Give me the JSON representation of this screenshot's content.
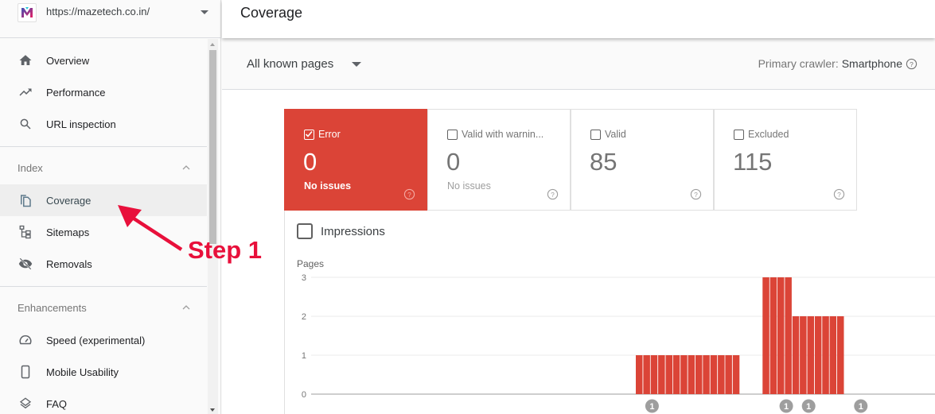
{
  "property": {
    "url": "https://mazetech.co.in/",
    "logo_icon": "mazetech-logo",
    "dropdown_icon": "caret-down-icon"
  },
  "sidebar": {
    "top_items": [
      {
        "label": "Overview",
        "icon": "home-icon"
      },
      {
        "label": "Performance",
        "icon": "trending-up-icon"
      },
      {
        "label": "URL inspection",
        "icon": "search-icon"
      }
    ],
    "sections": [
      {
        "title": "Index",
        "expanded": true,
        "items": [
          {
            "label": "Coverage",
            "icon": "coverage-copy-icon",
            "active": true
          },
          {
            "label": "Sitemaps",
            "icon": "sitemap-icon"
          },
          {
            "label": "Removals",
            "icon": "eye-off-icon"
          }
        ]
      },
      {
        "title": "Enhancements",
        "expanded": true,
        "items": [
          {
            "label": "Speed (experimental)",
            "icon": "speedometer-icon"
          },
          {
            "label": "Mobile Usability",
            "icon": "smartphone-icon"
          },
          {
            "label": "FAQ",
            "icon": "layers-icon"
          }
        ]
      }
    ]
  },
  "header": {
    "title": "Coverage"
  },
  "filter": {
    "selected": "All known pages",
    "crawler_label": "Primary crawler:",
    "crawler_value": "Smartphone"
  },
  "cards": [
    {
      "label": "Error",
      "value": "0",
      "sub": "No issues",
      "checked": true,
      "color": "#db4437"
    },
    {
      "label": "Valid with warnin...",
      "value": "0",
      "sub": "No issues",
      "checked": false
    },
    {
      "label": "Valid",
      "value": "85",
      "sub": "",
      "checked": false
    },
    {
      "label": "Excluded",
      "value": "115",
      "sub": "",
      "checked": false
    }
  ],
  "impressions": {
    "label": "Impressions",
    "checked": false
  },
  "annotation": {
    "text": "Step 1",
    "color": "#e8103b"
  },
  "chart_data": {
    "type": "bar",
    "title": "",
    "ylabel": "Pages",
    "xlabel": "",
    "ylim": [
      0,
      3
    ],
    "yticks": [
      0,
      1,
      2,
      3
    ],
    "grid": true,
    "series": [
      {
        "name": "Error",
        "color": "#db4437",
        "values": [
          0,
          0,
          0,
          0,
          0,
          0,
          0,
          0,
          0,
          0,
          0,
          0,
          0,
          0,
          0,
          0,
          0,
          0,
          0,
          0,
          0,
          0,
          0,
          0,
          0,
          0,
          0,
          0,
          0,
          0,
          0,
          0,
          0,
          0,
          0,
          0,
          0,
          0,
          0,
          0,
          0,
          0,
          0,
          0,
          1,
          1,
          1,
          1,
          1,
          1,
          1,
          1,
          1,
          1,
          1,
          1,
          1,
          1,
          0,
          0,
          0,
          3,
          3,
          3,
          3,
          2,
          2,
          2,
          2,
          2,
          2,
          2,
          0,
          0,
          0,
          0,
          0,
          0,
          0,
          0,
          0,
          0,
          0,
          0,
          0,
          0,
          0,
          0
        ]
      }
    ],
    "annotations": [
      {
        "index": 46,
        "label": "1"
      },
      {
        "index": 64,
        "label": "1"
      },
      {
        "index": 67,
        "label": "1"
      },
      {
        "index": 74,
        "label": "1"
      }
    ]
  }
}
